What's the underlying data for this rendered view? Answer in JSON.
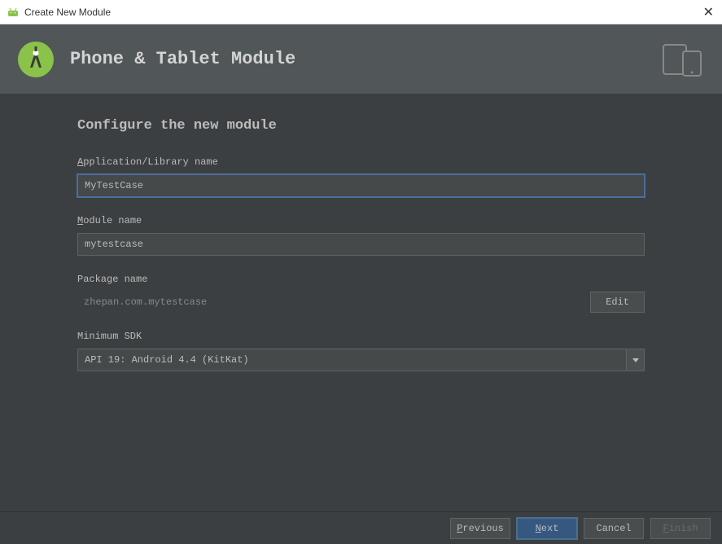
{
  "window": {
    "title": "Create New Module"
  },
  "header": {
    "title": "Phone & Tablet Module"
  },
  "content": {
    "heading": "Configure the new module",
    "fields": {
      "appName": {
        "label_prefix": "A",
        "label_rest": "pplication/Library name",
        "value": "MyTestCase"
      },
      "moduleName": {
        "label_prefix": "M",
        "label_rest": "odule name",
        "value": "mytestcase"
      },
      "packageName": {
        "label": "Package name",
        "value": "zhepan.com.mytestcase",
        "editLabel": "Edit"
      },
      "minSdk": {
        "label": "Minimum SDK",
        "value": "API 19: Android 4.4 (KitKat)"
      }
    }
  },
  "footer": {
    "previous_prefix": "P",
    "previous_rest": "revious",
    "next_prefix": "N",
    "next_rest": "ext",
    "cancel": "Cancel",
    "finish_prefix": "F",
    "finish_rest": "inish"
  },
  "colors": {
    "accent": "#365880",
    "background": "#3c3f41",
    "headerBg": "#515658"
  }
}
